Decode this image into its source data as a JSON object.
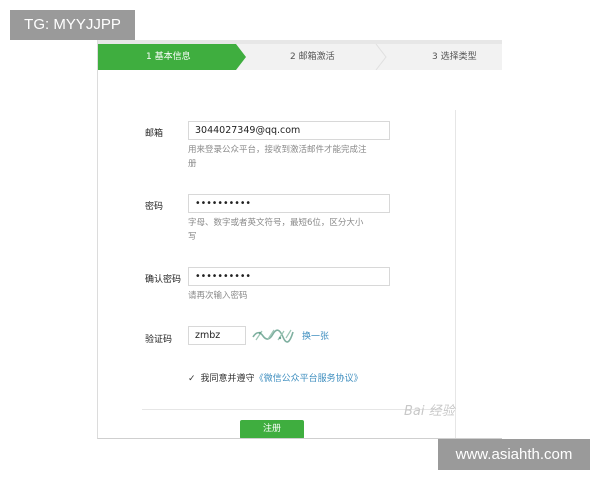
{
  "badges": {
    "tg": "TG: MYYJJPP",
    "site": "www.asiahth.com"
  },
  "steps": [
    {
      "label": "1 基本信息",
      "active": true
    },
    {
      "label": "2 邮箱激活",
      "active": false
    },
    {
      "label": "3 选择类型",
      "active": false
    }
  ],
  "colors": {
    "accent": "#3fae3f",
    "link": "#3e8ebf"
  },
  "form": {
    "email": {
      "label": "邮箱",
      "value": "3044027349@qq.com",
      "hint_1": "用来登录公众平台，接收到激活邮件才能完成注",
      "hint_2": "册"
    },
    "password": {
      "label": "密码",
      "value": "••••••••••",
      "hint_1": "字母、数字或者英文符号，最短6位，区分大小",
      "hint_2": "写"
    },
    "confirm": {
      "label": "确认密码",
      "value": "••••••••••",
      "hint": "请再次输入密码"
    },
    "captcha": {
      "label": "验证码",
      "value": "zmbz",
      "refresh": "换一张"
    },
    "agree": {
      "text": "我同意并遵守",
      "link": "《微信公众平台服务协议》"
    },
    "submit": "注册"
  },
  "watermark": "Bai 经验"
}
